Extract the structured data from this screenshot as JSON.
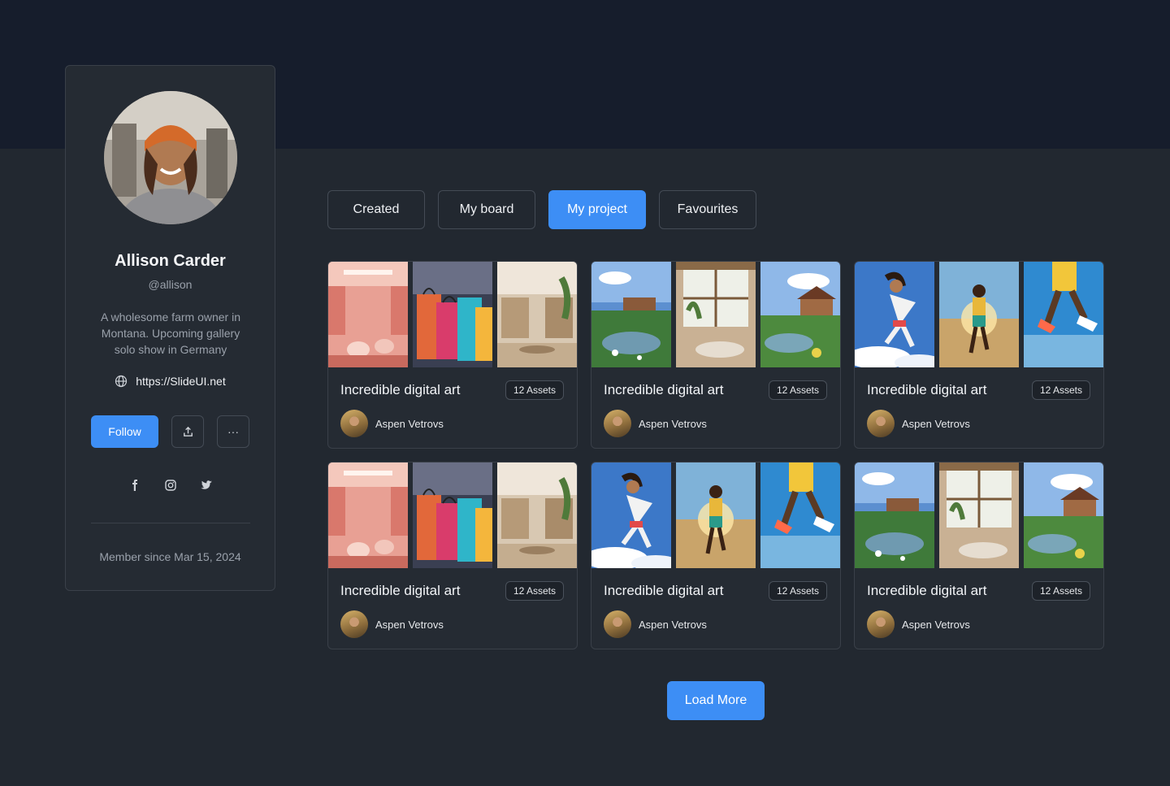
{
  "profile": {
    "name": "Allison Carder",
    "handle": "@allison",
    "bio": "A wholesome farm owner in Montana. Upcoming gallery solo show in Germany",
    "website": "https://SlideUI.net",
    "follow_label": "Follow",
    "more_label": "···",
    "member_since": "Member since Mar 15, 2024",
    "socials": [
      "facebook-icon",
      "instagram-icon",
      "twitter-icon"
    ]
  },
  "tabs": [
    {
      "label": "Created",
      "active": false
    },
    {
      "label": "My board",
      "active": false
    },
    {
      "label": "My project",
      "active": true
    },
    {
      "label": "Favourites",
      "active": false
    }
  ],
  "cards": [
    {
      "title": "Incredible digital art",
      "badge": "12 Assets",
      "author": "Aspen Vetrovs",
      "theme": "shop"
    },
    {
      "title": "Incredible digital art",
      "badge": "12 Assets",
      "author": "Aspen Vetrovs",
      "theme": "garden"
    },
    {
      "title": "Incredible digital art",
      "badge": "12 Assets",
      "author": "Aspen Vetrovs",
      "theme": "runner"
    },
    {
      "title": "Incredible digital art",
      "badge": "12 Assets",
      "author": "Aspen Vetrovs",
      "theme": "shop"
    },
    {
      "title": "Incredible digital art",
      "badge": "12 Assets",
      "author": "Aspen Vetrovs",
      "theme": "runner"
    },
    {
      "title": "Incredible digital art",
      "badge": "12 Assets",
      "author": "Aspen Vetrovs",
      "theme": "garden"
    }
  ],
  "load_more_label": "Load More",
  "colors": {
    "accent": "#3d8ef5",
    "banner": "#161d2c",
    "background": "#222830",
    "card": "#252b33"
  }
}
